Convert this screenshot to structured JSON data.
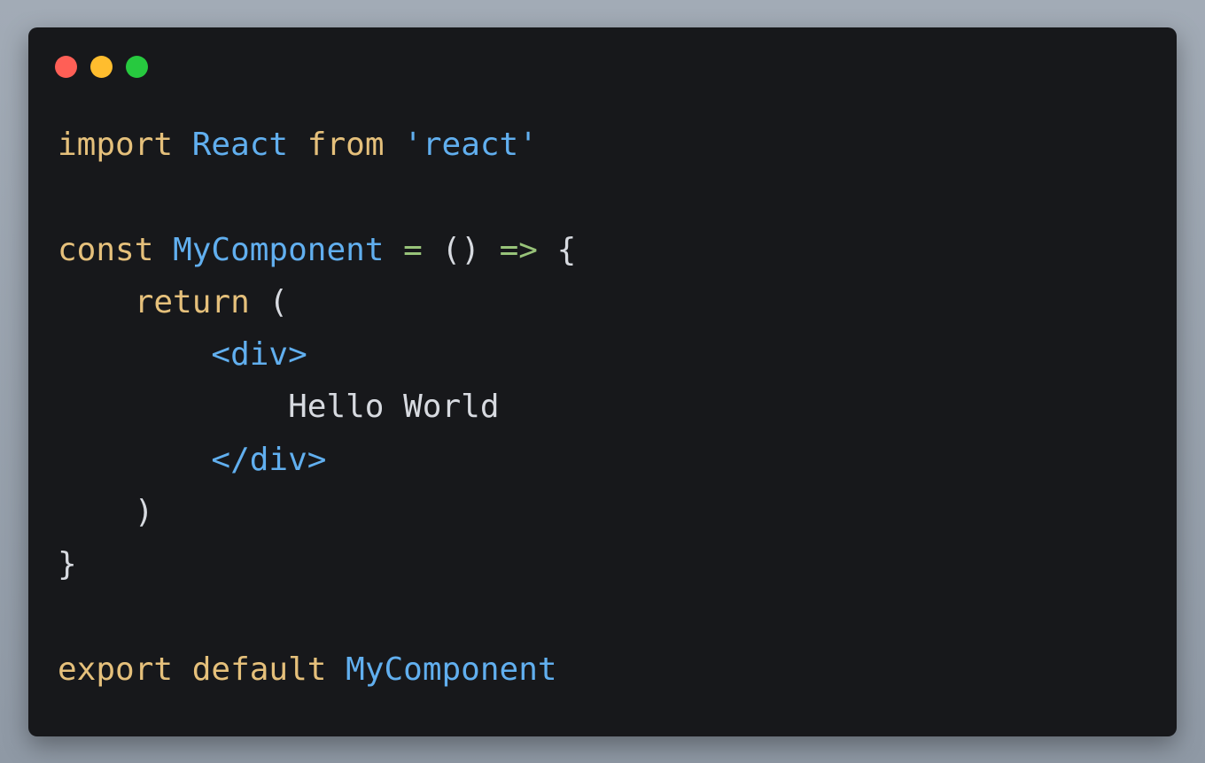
{
  "window": {
    "controls": [
      {
        "name": "close",
        "color": "#ff5f56"
      },
      {
        "name": "minimize",
        "color": "#ffbd2e"
      },
      {
        "name": "maximize",
        "color": "#27c93f"
      }
    ]
  },
  "colors": {
    "keyword": "#e5c07b",
    "identifier": "#61afef",
    "operator": "#98c379",
    "plain": "#d7dae0",
    "background": "#17181b"
  },
  "code": {
    "line1": {
      "kw_import": "import",
      "id_react": "React",
      "kw_from": "from",
      "str_react": "'react'"
    },
    "line3": {
      "kw_const": "const",
      "id_mycomponent": "MyComponent",
      "op_eq": "=",
      "parens": "()",
      "op_arrow": "=>",
      "brace_open": "{"
    },
    "line4": {
      "kw_return": "return",
      "paren_open": "("
    },
    "line5": {
      "tag_open": "<div>"
    },
    "line6": {
      "text": "Hello World"
    },
    "line7": {
      "tag_close": "</div>"
    },
    "line8": {
      "paren_close": ")"
    },
    "line9": {
      "brace_close": "}"
    },
    "line11": {
      "kw_export": "export",
      "kw_default": "default",
      "id_mycomponent": "MyComponent"
    }
  }
}
